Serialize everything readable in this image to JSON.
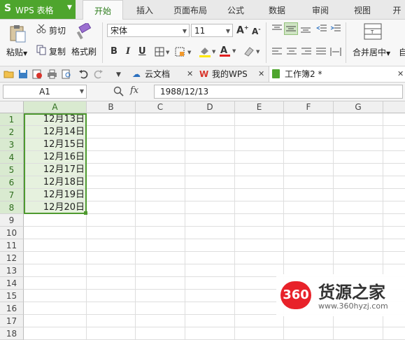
{
  "app": {
    "logo_letter": "S",
    "name": "WPS 表格"
  },
  "ribbon_tabs": [
    "开始",
    "插入",
    "页面布局",
    "公式",
    "数据",
    "审阅",
    "视图",
    "开"
  ],
  "clipboard": {
    "paste": "粘贴",
    "cut": "剪切",
    "copy": "复制",
    "format_painter": "格式刷"
  },
  "font": {
    "name": "宋体",
    "size": "11"
  },
  "format_buttons": {
    "bold": "B",
    "italic": "I",
    "underline": "U"
  },
  "merge": {
    "label": "合并居中"
  },
  "merge_next": {
    "label": "自"
  },
  "doc_tabs": [
    {
      "label": "云文档"
    },
    {
      "label": "我的WPS"
    },
    {
      "label": "工作簿2 *"
    }
  ],
  "formula_bar": {
    "cell_ref": "A1",
    "fx": "fx",
    "value": "1988/12/13"
  },
  "columns": [
    "A",
    "B",
    "C",
    "D",
    "E",
    "F",
    "G"
  ],
  "rows": [
    "1",
    "2",
    "3",
    "4",
    "5",
    "6",
    "7",
    "8",
    "9",
    "10",
    "11",
    "12",
    "13",
    "14",
    "15",
    "16",
    "17",
    "18"
  ],
  "cells": {
    "A": [
      "12月13日",
      "12月14日",
      "12月15日",
      "12月16日",
      "12月17日",
      "12月18日",
      "12月19日",
      "12月20日"
    ]
  },
  "watermark": {
    "badge": "360",
    "title": "货源之家",
    "url": "www.360hyzj.com"
  },
  "colors": {
    "accent": "#4ea52d",
    "selection": "#e6f1de",
    "badge": "#e8222a"
  }
}
